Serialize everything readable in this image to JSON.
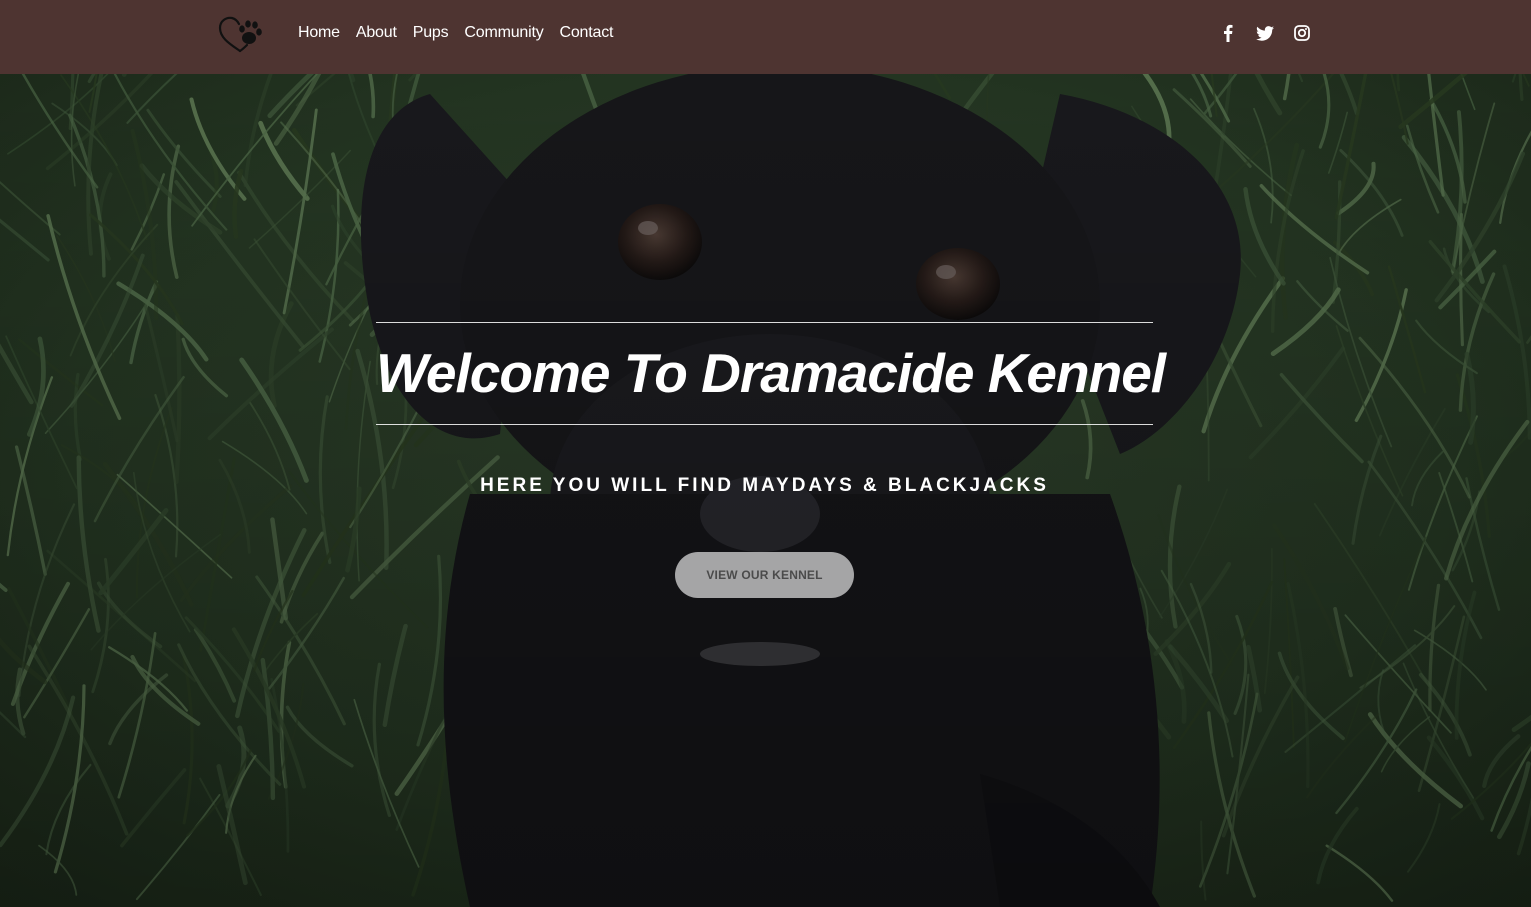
{
  "colors": {
    "header_bg": "#4e3431",
    "grass_dark": "#1e2b1b",
    "puppy": "#151518",
    "text": "#ffffff",
    "button_bg": "#b9b9bb",
    "button_text": "#4b4b4b"
  },
  "header": {
    "logo_icon": "heart-paw-icon",
    "nav": [
      {
        "label": "Home"
      },
      {
        "label": "About"
      },
      {
        "label": "Pups"
      },
      {
        "label": "Community"
      },
      {
        "label": "Contact"
      }
    ],
    "social": [
      {
        "icon": "facebook-icon"
      },
      {
        "icon": "twitter-icon"
      },
      {
        "icon": "instagram-icon"
      }
    ]
  },
  "hero": {
    "background": "black puppy in grass photo",
    "title": "Welcome To Dramacide Kennel",
    "subtitle": "HERE YOU WILL FIND MAYDAYS & BLACKJACKS",
    "cta_label": "VIEW OUR KENNEL"
  }
}
